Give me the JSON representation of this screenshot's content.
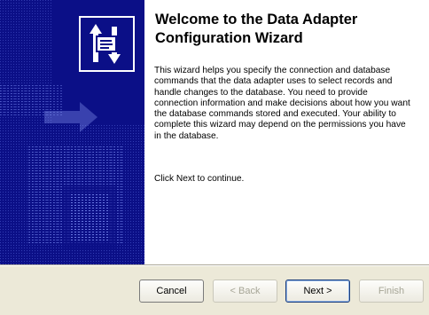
{
  "wizard": {
    "title": "Welcome to the Data Adapter Configuration Wizard",
    "description": "This wizard helps you specify the connection and database commands that the data adapter uses to select records and handle changes to the database. You need to provide connection information and make decisions about how you want the database commands stored and executed. Your ability to complete this wizard may depend on the permissions you have in the database.",
    "continue_text": "Click Next to continue."
  },
  "buttons": {
    "cancel": "Cancel",
    "back": "< Back",
    "next": "Next >",
    "finish": "Finish"
  },
  "colors": {
    "banner": "#0b0f87",
    "dialog_bg": "#ece9d8",
    "content_bg": "#ffffff"
  },
  "icons": {
    "banner_icon": "data-adapter-icon"
  }
}
